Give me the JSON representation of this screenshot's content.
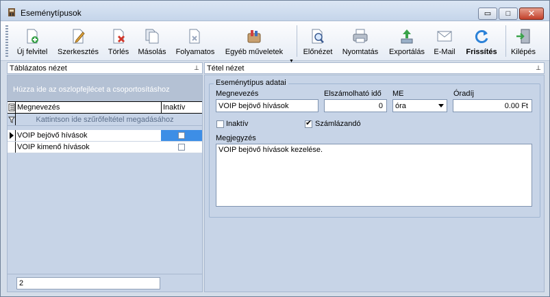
{
  "window": {
    "title": "Eseménytípusok",
    "min_glyph": "▭",
    "max_glyph": "□",
    "close_glyph": "✕"
  },
  "toolbar": {
    "new": "Új felvitel",
    "edit": "Szerkesztés",
    "delete": "Törlés",
    "copy": "Másolás",
    "continuous": "Folyamatos",
    "other": "Egyéb műveletek",
    "other_arrow": "▼",
    "preview": "Előnézet",
    "print": "Nyomtatás",
    "export": "Exportálás",
    "email": "E-Mail",
    "refresh": "Frissítés",
    "exit": "Kilépés"
  },
  "left_panel": {
    "title": "Táblázatos nézet",
    "pin": "⊥",
    "group_hint": "Húzza ide az oszlopfejlécet a csoportosításhoz",
    "columns": [
      "Megnevezés",
      "Inaktív"
    ],
    "filter_hint": "Kattintson ide szűrőfeltétel megadásához",
    "rows": [
      {
        "name": "VOIP bejövő hívások",
        "inactive": false,
        "selected": true
      },
      {
        "name": "VOIP kimenő hívások",
        "inactive": false,
        "selected": false
      }
    ],
    "record_count": "2"
  },
  "right_panel": {
    "title": "Tétel nézet",
    "pin": "⊥",
    "group_title": "Eseménytípus adatai",
    "labels": {
      "name": "Megnevezés",
      "billable_time": "Elszámolható idő",
      "unit": "ME",
      "hourly_rate": "Óradíj",
      "inactive": "Inaktív",
      "billable": "Számlázandó",
      "note": "Megjegyzés"
    },
    "values": {
      "name": "VOIP bejövő hívások",
      "billable_time": "0",
      "unit": "óra",
      "hourly_rate": "0.00 Ft",
      "inactive": false,
      "billable": true,
      "note": "VOIP bejövő hívások kezelése."
    },
    "check_mark": "✔"
  }
}
